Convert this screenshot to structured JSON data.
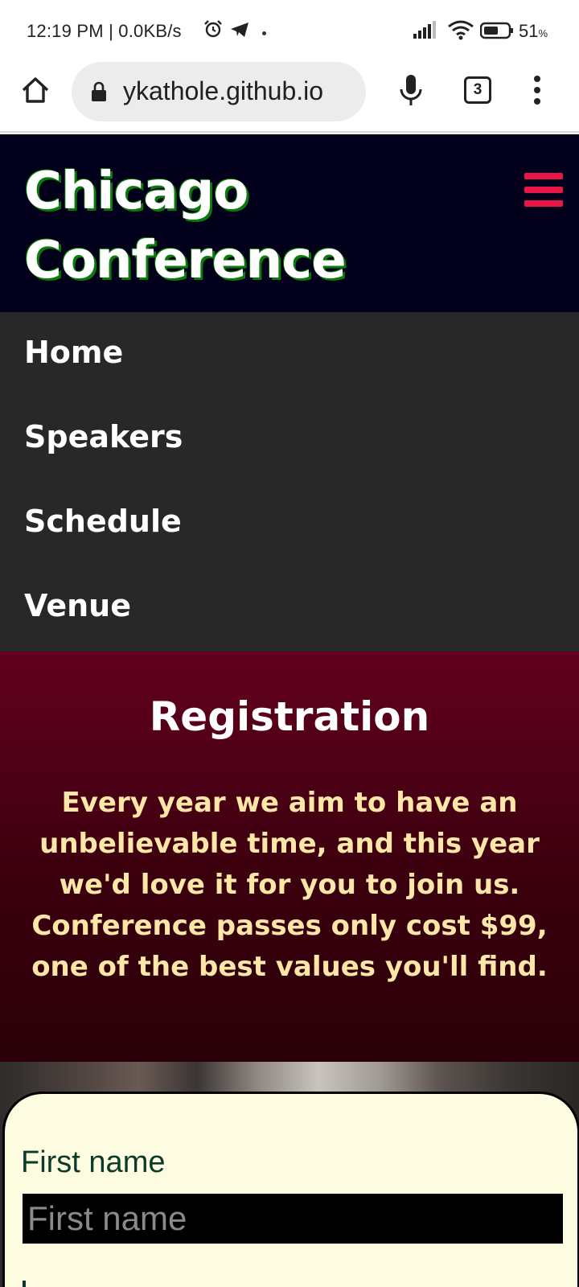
{
  "status_bar": {
    "time_speed": "12:19 PM | 0.0KB/s",
    "battery": "51",
    "battery_unit": "%",
    "icons": [
      "alarm-icon",
      "telegram-icon",
      "signal-icon",
      "wifi-icon",
      "battery-icon"
    ]
  },
  "browser": {
    "url": "ykathole.github.io",
    "tab_count": "3"
  },
  "site": {
    "title_line1": "Chicago",
    "title_line2": "Conference",
    "accent_color": "#e8174a",
    "header_bg": "#02001a"
  },
  "nav": {
    "items": [
      {
        "label": "Home"
      },
      {
        "label": "Speakers"
      },
      {
        "label": "Schedule"
      },
      {
        "label": "Venue"
      }
    ]
  },
  "registration": {
    "title": "Registration",
    "body": "Every year we aim to have an unbelievable time, and this year we'd love it for you to join us. Conference passes only cost $99, one of the best values you'll find.",
    "body_color": "#fce7a6"
  },
  "form": {
    "first_name_label": "First name",
    "first_name_placeholder": "First name",
    "first_name_value": ""
  }
}
